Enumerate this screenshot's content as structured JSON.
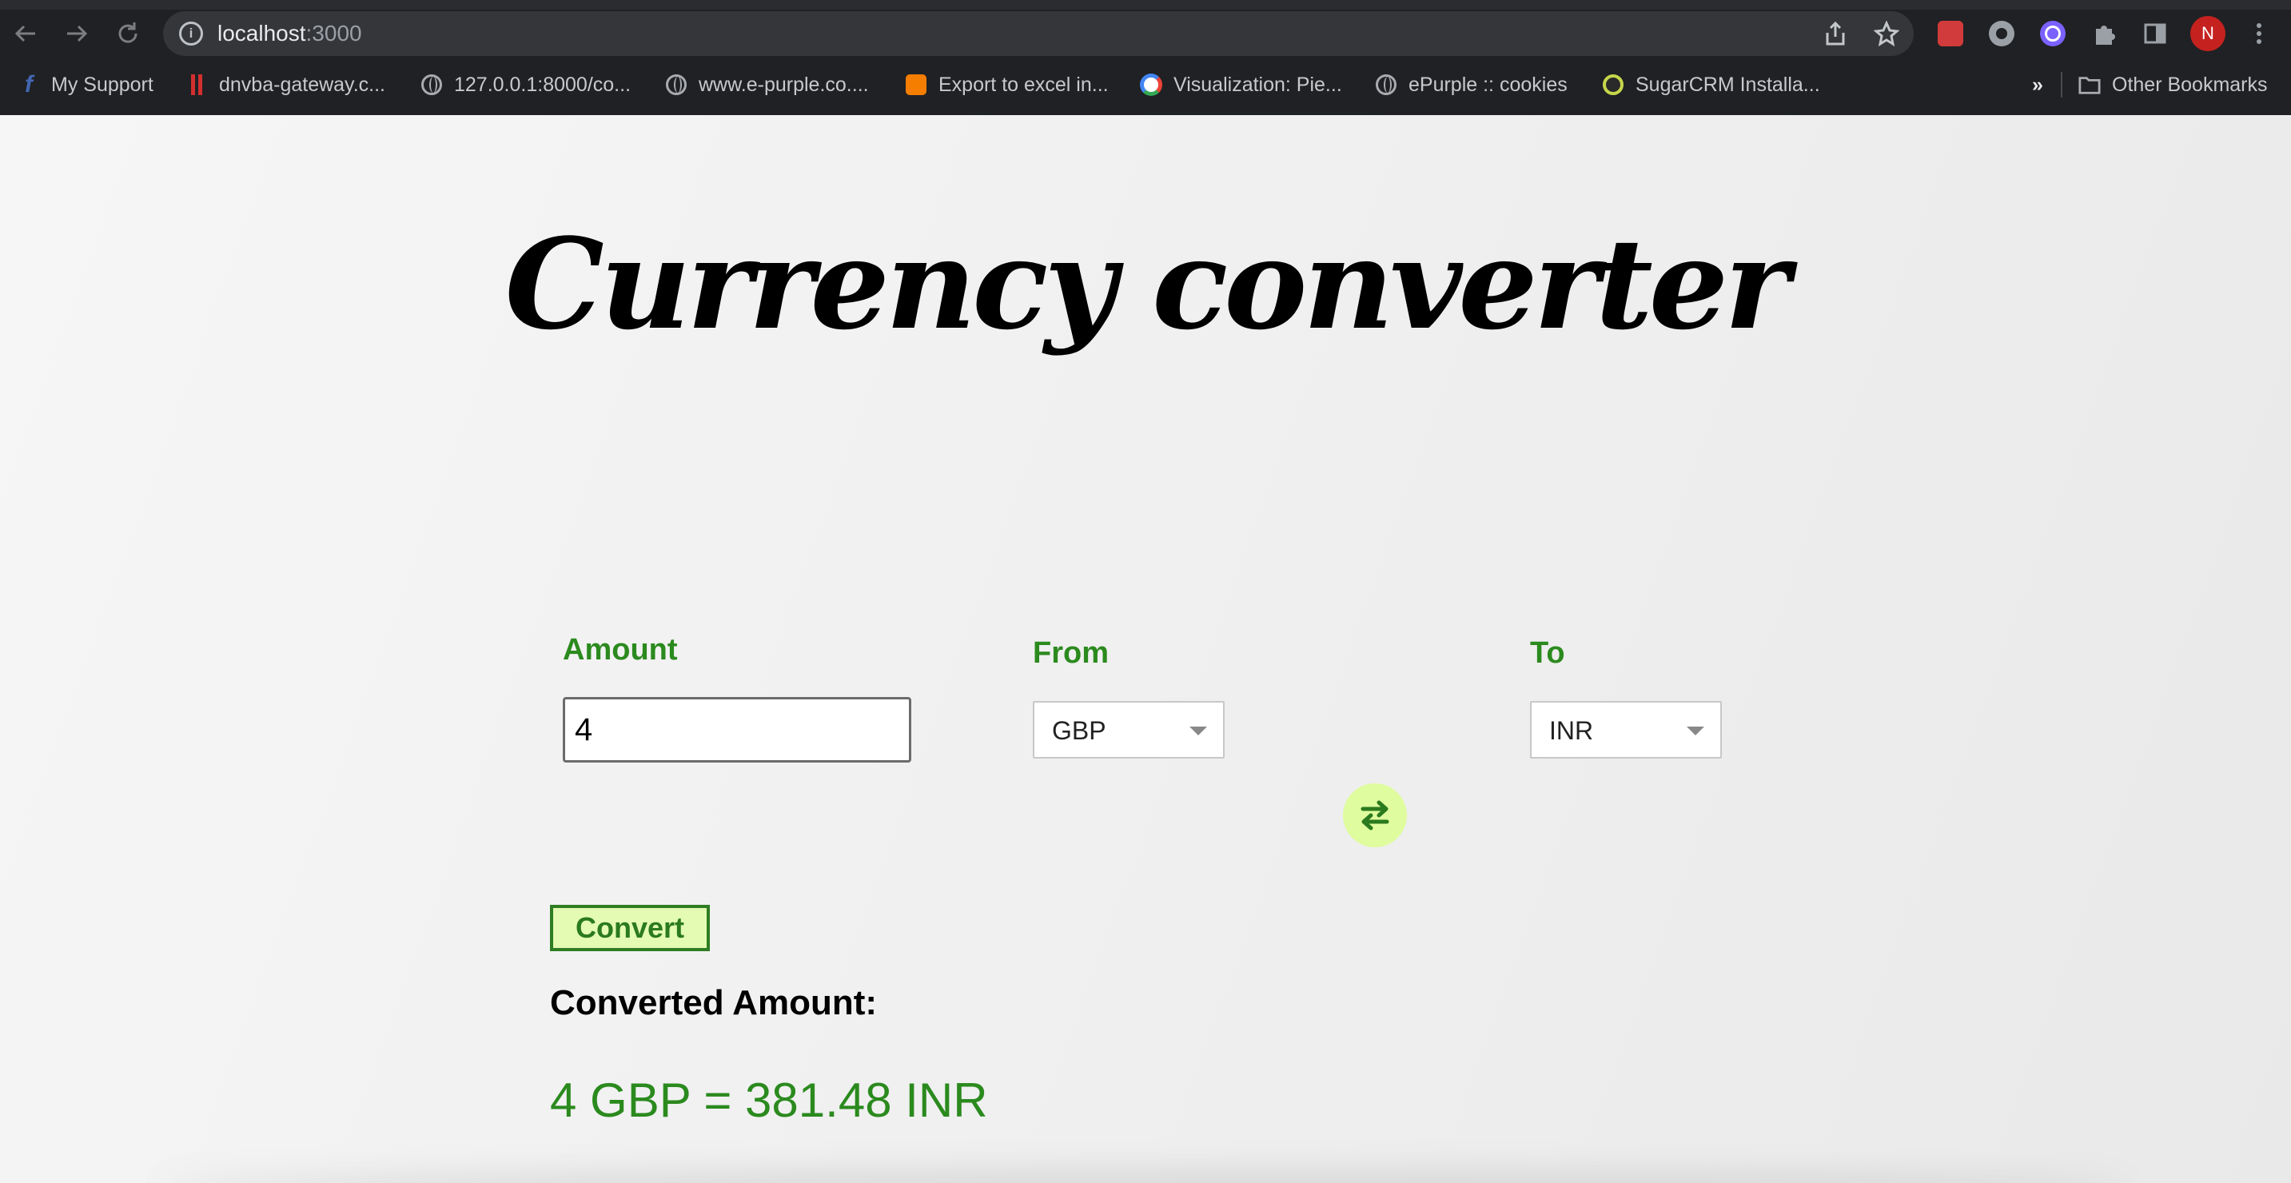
{
  "browser": {
    "url_host": "localhost",
    "url_port": ":3000",
    "avatar_initial": "N",
    "bookmarks": [
      {
        "label": "My Support",
        "icon": "facebook-icon"
      },
      {
        "label": "dnvba-gateway.c...",
        "icon": "red-bars-icon"
      },
      {
        "label": "127.0.0.1:8000/co...",
        "icon": "globe-icon"
      },
      {
        "label": "www.e-purple.co....",
        "icon": "globe-icon"
      },
      {
        "label": "Export to excel in...",
        "icon": "blogger-icon"
      },
      {
        "label": "Visualization: Pie...",
        "icon": "google-dev-icon"
      },
      {
        "label": "ePurple :: cookies",
        "icon": "globe-icon"
      },
      {
        "label": "SugarCRM Installa...",
        "icon": "sugarcrm-icon"
      }
    ],
    "more_bookmarks": "»",
    "other_bookmarks": "Other Bookmarks"
  },
  "page": {
    "title": "Currency converter",
    "amount_label": "Amount",
    "amount_value": "4",
    "from_label": "From",
    "from_value": "GBP",
    "to_label": "To",
    "to_value": "INR",
    "convert_label": "Convert",
    "result_heading": "Converted Amount:",
    "result_text": "4 GBP = 381.48 INR"
  },
  "colors": {
    "accent_green": "#2b8a1e",
    "swap_button_bg": "#dffc9e",
    "convert_button_bg": "#e4fbb4"
  }
}
